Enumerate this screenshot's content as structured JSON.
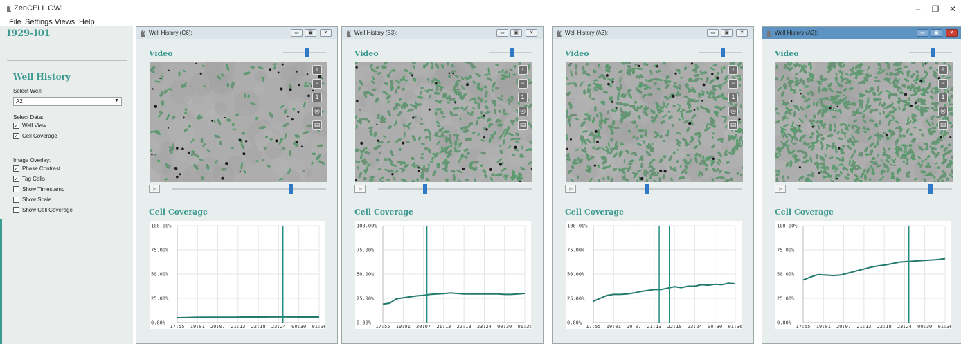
{
  "app": {
    "title": "ZenCELL OWL",
    "window_controls": {
      "minimize": "–",
      "maximize": "❐",
      "close": "✕"
    }
  },
  "menu": [
    "File",
    "Settings",
    "Views",
    "Help"
  ],
  "left_panel": {
    "experiment_id": "I929-I01",
    "section_title": "Well History",
    "select_well_label": "Select Well:",
    "selected_well": "A2",
    "select_data_label": "Select Data:",
    "data_options": [
      {
        "label": "Well View",
        "checked": true
      },
      {
        "label": "Cell Coverage",
        "checked": true
      }
    ],
    "image_overlay_label": "Image Overlay:",
    "overlay_options": [
      {
        "label": "Phase Contrast",
        "checked": true
      },
      {
        "label": "Tag Cells",
        "checked": true
      },
      {
        "label": "Show Timestamp",
        "checked": false
      },
      {
        "label": "Show Scale",
        "checked": false
      },
      {
        "label": "Show Cell Coverage",
        "checked": false
      }
    ],
    "accent_color": "#3d9a90"
  },
  "panels": [
    {
      "title": "Well History (C6):",
      "video_label": "Video",
      "coverage_label": "Cell Coverage",
      "zoom_level": 0.55,
      "time_position": 0.78,
      "cell_density": 0.12,
      "tools": [
        "zoom-in-icon",
        "zoom-out-icon",
        "zoom-reset-icon",
        "fit-icon",
        "save-icon"
      ],
      "active": false
    },
    {
      "title": "Well History (B3):",
      "video_label": "Video",
      "coverage_label": "Cell Coverage",
      "zoom_level": 0.55,
      "time_position": 0.3,
      "cell_density": 0.55,
      "tools": [
        "zoom-in-icon",
        "zoom-out-icon",
        "zoom-reset-icon",
        "fit-icon",
        "save-icon"
      ],
      "active": false
    },
    {
      "title": "Well History (A3):",
      "video_label": "Video",
      "coverage_label": "Cell Coverage",
      "zoom_level": 0.55,
      "time_position": 0.38,
      "cell_density": 0.7,
      "tools": [
        "zoom-in-icon",
        "zoom-out-icon",
        "zoom-reset-icon",
        "fit-icon",
        "save-icon"
      ],
      "active": false
    },
    {
      "title": "Well History (A2):",
      "video_label": "Video",
      "coverage_label": "Cell Coverage",
      "zoom_level": 0.55,
      "time_position": 0.87,
      "cell_density": 1.0,
      "tools": [
        "zoom-in-icon",
        "zoom-out-icon",
        "zoom-reset-icon",
        "fit-icon",
        "save-icon"
      ],
      "active": true
    }
  ],
  "chart_data": [
    {
      "type": "line",
      "well": "C6",
      "categories": [
        "17:55",
        "19:01",
        "20:07",
        "21:13",
        "22:18",
        "23:24",
        "00:30",
        "01:36"
      ],
      "y_ticks": [
        "0.00%",
        "25.00%",
        "50.00%",
        "75.00%",
        "100.00%"
      ],
      "ylim": [
        0,
        100
      ],
      "grid": true,
      "values": [
        5,
        5.2,
        5.4,
        5.5,
        5.5,
        5.6,
        5.6,
        5.7,
        5.7,
        5.7,
        5.8,
        5.8,
        5.8,
        5.7,
        5.7,
        5.7
      ],
      "cursors": [
        23.64
      ],
      "line_color": "#227a6d"
    },
    {
      "type": "line",
      "well": "B3",
      "categories": [
        "17:55",
        "19:01",
        "20:07",
        "21:13",
        "22:18",
        "23:24",
        "00:30",
        "01:36"
      ],
      "y_ticks": [
        "0.00%",
        "25.00%",
        "50.00%",
        "75.00%",
        "100.00%"
      ],
      "ylim": [
        0,
        100
      ],
      "grid": true,
      "values": [
        19,
        20,
        24.5,
        25.5,
        26.5,
        27.5,
        28,
        29,
        29.5,
        29.8,
        30.5,
        30,
        29.5,
        29.5,
        29.5,
        29.5,
        29.5,
        29.5,
        29,
        29,
        29.5,
        30
      ],
      "cursors": [
        20.3
      ],
      "line_color": "#227a6d"
    },
    {
      "type": "line",
      "well": "A3",
      "categories": [
        "17:55",
        "19:01",
        "20:07",
        "21:13",
        "22:18",
        "23:24",
        "00:30",
        "01:36"
      ],
      "y_ticks": [
        "0.00%",
        "25.00%",
        "50.00%",
        "75.00%",
        "100.00%"
      ],
      "ylim": [
        0,
        100
      ],
      "grid": true,
      "values": [
        22,
        25,
        28,
        29,
        29,
        29.5,
        30.5,
        32,
        33,
        34,
        34,
        35.5,
        37,
        36,
        37.5,
        37.5,
        39,
        38.5,
        39.5,
        39,
        40.5,
        40
      ],
      "cursors": [
        21.48,
        22.03
      ],
      "line_color": "#227a6d"
    },
    {
      "type": "line",
      "well": "A2",
      "categories": [
        "17:55",
        "19:01",
        "20:07",
        "21:13",
        "22:18",
        "23:24",
        "00:30",
        "01:36"
      ],
      "y_ticks": [
        "0.00%",
        "25.00%",
        "50.00%",
        "75.00%",
        "100.00%"
      ],
      "ylim": [
        0,
        100
      ],
      "grid": true,
      "values": [
        44,
        47,
        49.5,
        49,
        48.5,
        49,
        51,
        53,
        55,
        57,
        58.5,
        59.5,
        61,
        62.5,
        63,
        63.5,
        64,
        64.5,
        65,
        66
      ],
      "cursors": [
        23.64
      ],
      "line_color": "#227a6d"
    }
  ]
}
